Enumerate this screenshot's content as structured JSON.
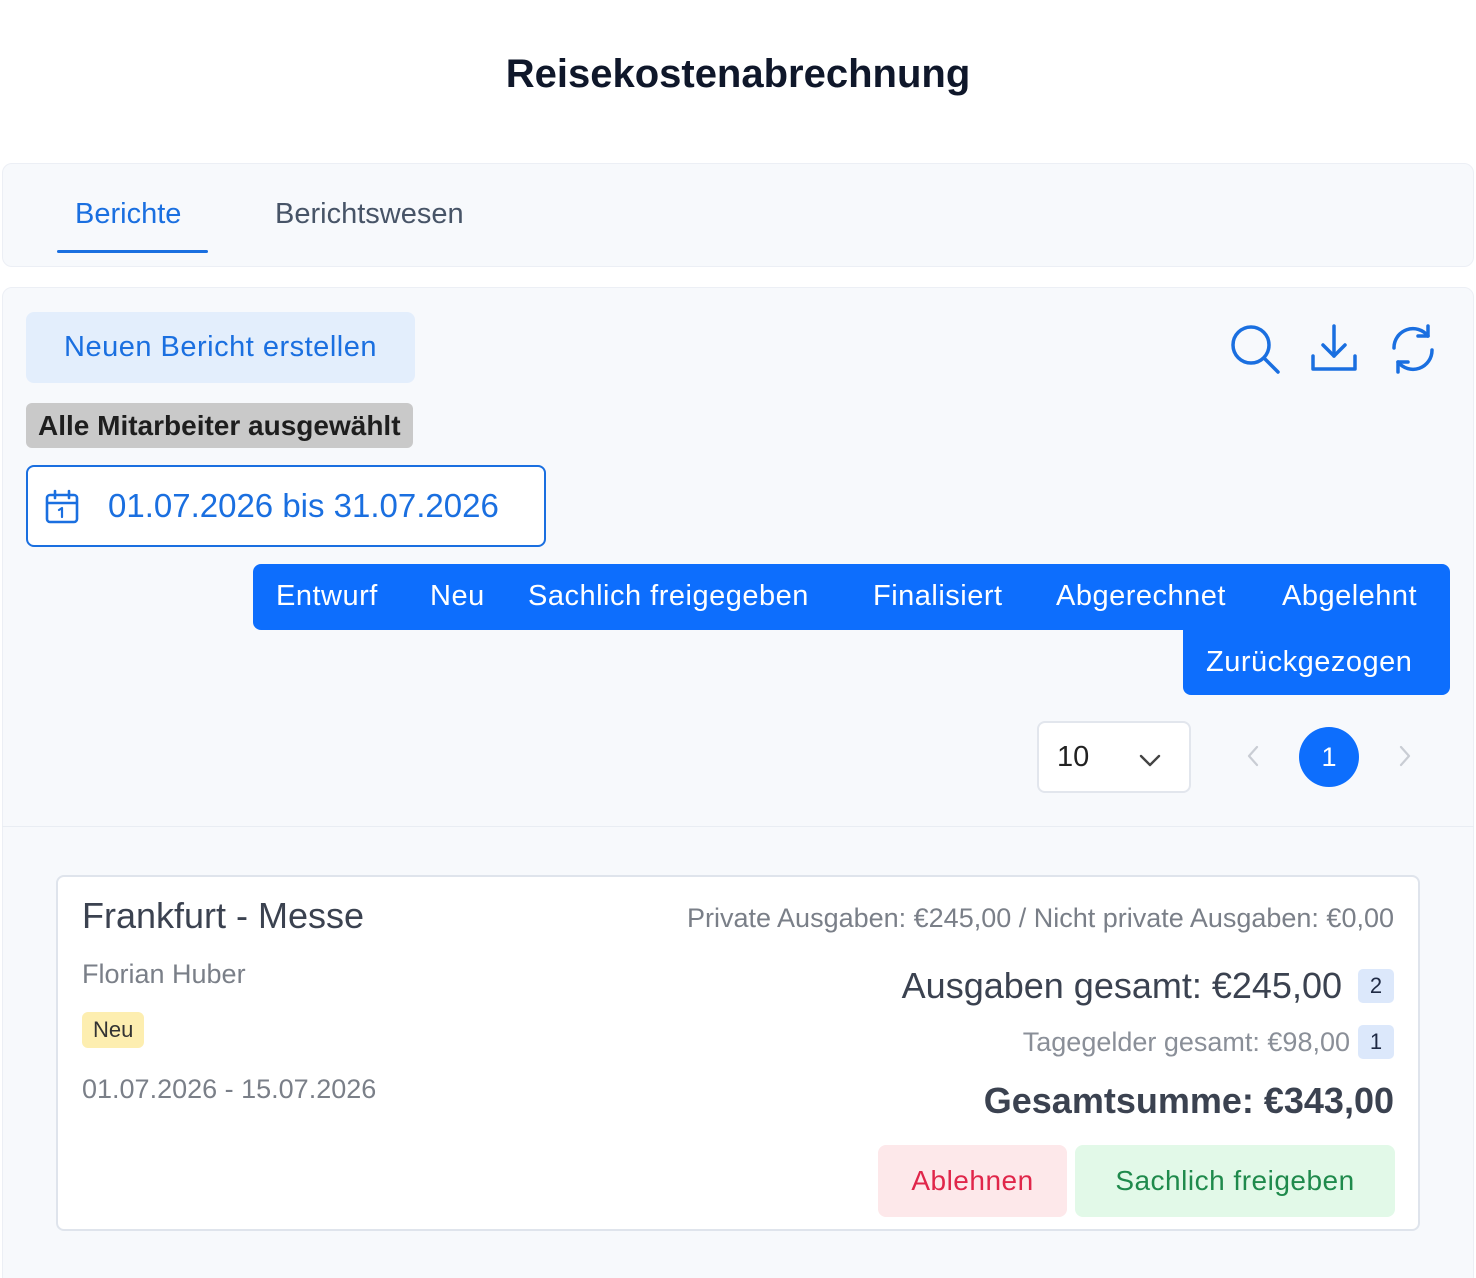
{
  "page": {
    "title": "Reisekostenabrechnung"
  },
  "tabs": [
    {
      "label": "Berichte",
      "active": true
    },
    {
      "label": "Berichtswesen",
      "active": false
    }
  ],
  "toolbar": {
    "new_report_label": "Neuen Bericht erstellen",
    "icons": [
      "search-icon",
      "download-icon",
      "refresh-icon"
    ]
  },
  "filters": {
    "employee_chip": "Alle Mitarbeiter ausgewählt",
    "date_range": "01.07.2026 bis 31.07.2026",
    "statuses": [
      "Entwurf",
      "Neu",
      "Sachlich freigegeben",
      "Finalisiert",
      "Abgerechnet",
      "Abgelehnt",
      "Zurückgezogen"
    ]
  },
  "pagination": {
    "page_size": "10",
    "current_page": "1"
  },
  "report": {
    "title": "Frankfurt - Messe",
    "person": "Florian Huber",
    "status": "Neu",
    "dates": "01.07.2026 - 15.07.2026",
    "private_expenses": "Private Ausgaben: €245,00 / Nicht private Ausgaben: €0,00",
    "expenses_total": "Ausgaben gesamt: €245,00",
    "expenses_count": "2",
    "allowances_total": "Tagegelder gesamt: €98,00",
    "allowances_count": "1",
    "grand_total": "Gesamtsumme: €343,00",
    "reject_label": "Ablehnen",
    "approve_label": "Sachlich freigeben"
  },
  "colors": {
    "primary": "#0d6efd",
    "accent_text": "#1a6fe0",
    "reject": "#e0264a",
    "approve": "#1f8a4c",
    "badge_new": "#fdeeb0"
  }
}
